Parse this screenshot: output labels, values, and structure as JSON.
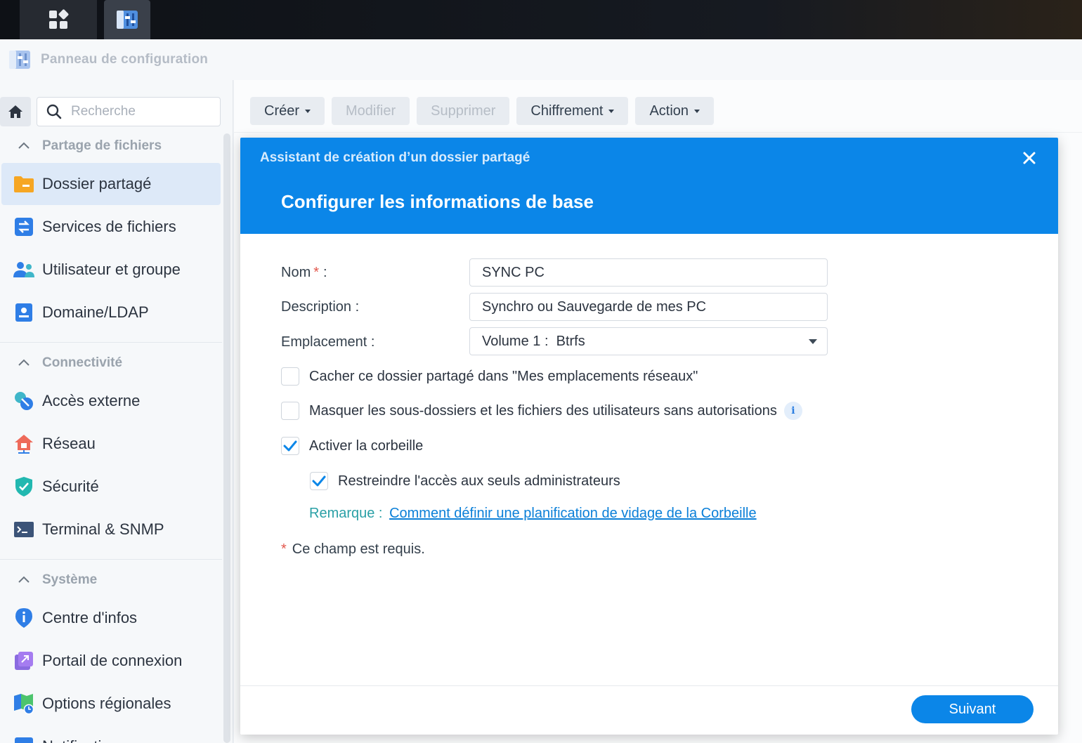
{
  "window": {
    "title": "Panneau de configuration"
  },
  "sidebar": {
    "search_placeholder": "Recherche",
    "sections": [
      {
        "label": "Partage de fichiers",
        "items": [
          {
            "label": "Dossier partagé",
            "icon": "folder-icon",
            "active": true
          },
          {
            "label": "Services de fichiers",
            "icon": "file-services-icon"
          },
          {
            "label": "Utilisateur et groupe",
            "icon": "users-icon"
          },
          {
            "label": "Domaine/LDAP",
            "icon": "domain-icon"
          }
        ]
      },
      {
        "label": "Connectivité",
        "items": [
          {
            "label": "Accès externe",
            "icon": "external-access-icon"
          },
          {
            "label": "Réseau",
            "icon": "network-icon"
          },
          {
            "label": "Sécurité",
            "icon": "shield-icon"
          },
          {
            "label": "Terminal & SNMP",
            "icon": "terminal-icon"
          }
        ]
      },
      {
        "label": "Système",
        "items": [
          {
            "label": "Centre d'infos",
            "icon": "info-icon"
          },
          {
            "label": "Portail de connexion",
            "icon": "portal-icon"
          },
          {
            "label": "Options régionales",
            "icon": "regional-options-icon"
          },
          {
            "label": "Notification",
            "icon": "notification-icon"
          }
        ]
      }
    ]
  },
  "toolbar": {
    "create": "Créer",
    "edit": "Modifier",
    "delete": "Supprimer",
    "encryption": "Chiffrement",
    "action": "Action"
  },
  "dialog": {
    "title": "Assistant de création d’un dossier partagé",
    "subtitle": "Configurer les informations de base",
    "fields": {
      "name_label": "Nom",
      "name_value": "SYNC PC",
      "description_label": "Description",
      "description_value": "Synchro ou Sauvegarde de mes PC",
      "location_label": "Emplacement",
      "location_value": "Volume 1 :  Btrfs",
      "colon": ":",
      "required_mark": "*"
    },
    "options": [
      {
        "label": "Cacher ce dossier partagé dans \"Mes emplacements réseaux\"",
        "checked": false
      },
      {
        "label": "Masquer les sous-dossiers et les fichiers des utilisateurs sans autorisations",
        "checked": false
      },
      {
        "label": "Activer la corbeille",
        "checked": true
      },
      {
        "label": "Restreindre l'accès aux seuls administrateurs",
        "checked": true
      }
    ],
    "remark_label": "Remarque :",
    "remark_link": "Comment définir une planification de vidage de la Corbeille",
    "required_note": "Ce champ est requis.",
    "next_button": "Suivant"
  },
  "colors": {
    "accent": "#0b86e8",
    "active_nav": "#dde9f8",
    "remark": "#2aa0a6",
    "required": "#e2574c"
  }
}
